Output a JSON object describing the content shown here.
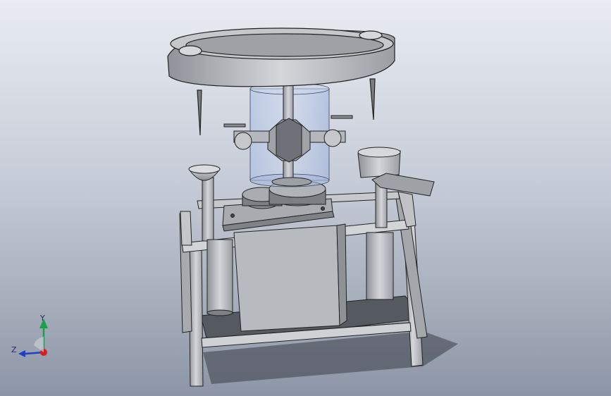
{
  "viewport": {
    "background_top": "#e9ecf2",
    "background_bottom": "#8d96a6",
    "model_color": "#b9bcc1",
    "edge_color": "#222222",
    "glass_color": "#9fb8e6"
  },
  "triad": {
    "y_label": "Y",
    "z_label": "Z",
    "y_color": "#1aa04a",
    "z_color": "#1f3fc4",
    "x_color": "#d71f1f"
  }
}
